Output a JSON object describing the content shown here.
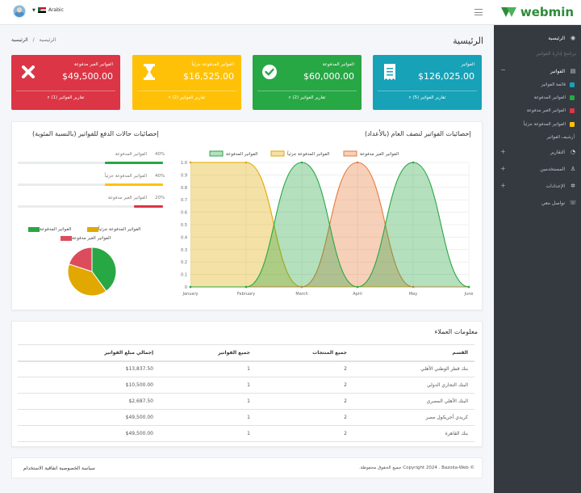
{
  "topbar": {
    "language": "Arabic"
  },
  "brand": {
    "name": "webmin"
  },
  "sidebar": {
    "home": "الرئيسية",
    "program": "برنامج إدارة الفواتير",
    "invoices": "الفواتير",
    "sub": [
      {
        "label": "قائمة الفواتير",
        "color": "#17a2b8"
      },
      {
        "label": "الفواتير المدفوعة",
        "color": "#28a745"
      },
      {
        "label": "الفواتير الغير مدفوعة",
        "color": "#dc3545"
      },
      {
        "label": "الفواتير المدفوعة جزئياً",
        "color": "#ffc107"
      },
      {
        "label": "أرشيف الفواتير",
        "color": ""
      }
    ],
    "reports": "التقارير",
    "users": "المستخدمين",
    "settings": "الإعدادات",
    "contact": "تواصل معي"
  },
  "header": {
    "breadcrumb_home": "الرئيسية",
    "breadcrumb_sep": "/",
    "breadcrumb_current": "الرئيسية",
    "title": "الرئيسية"
  },
  "cards": {
    "red": {
      "label": "الفواتير الغير مدفوعة",
      "amount": "$49,500.00",
      "link": "تقارير الفواتير (1)"
    },
    "yellow": {
      "label": "الفواتير المدفوعة جزئياً",
      "amount": "$16,525.00",
      "link": "تقارير الفواتير (2)"
    },
    "green": {
      "label": "الفواتير المدفوعة",
      "amount": "$60,000.00",
      "link": "تقارير الفواتير (2)"
    },
    "teal": {
      "label": "الفواتير",
      "amount": "$126,025.00",
      "link": "تقارير الفواتير (5)"
    }
  },
  "payments_panel": {
    "title": "إحصائيات حالات الدفع للفواتير (بالنسبة المئوية)",
    "bars": [
      {
        "label": "الفواتير المدفوعة",
        "pct": "40%",
        "value": 40,
        "color": "#28a745"
      },
      {
        "label": "الفواتير المدفوعة جزئياً",
        "pct": "40%",
        "value": 40,
        "color": "#ffc107"
      },
      {
        "label": "الفواتير الغير مدفوعة",
        "pct": "20%",
        "value": 20,
        "color": "#dc3545"
      }
    ],
    "pie_legend": [
      "الفواتير المدفوعة",
      "الفواتير المدفوعة جزئياً",
      "الفواتير الغير مدفوعة"
    ]
  },
  "chart_panel": {
    "title": "إحصائيات الفواتير لنصف العام (بالأعداد)"
  },
  "chart_data": [
    {
      "type": "area",
      "categories": [
        "January",
        "February",
        "March",
        "April",
        "May",
        "June"
      ],
      "ylim": [
        0,
        1
      ],
      "yticks": [
        "0",
        "0.1",
        "0.2",
        "0.3",
        "0.4",
        "0.5",
        "0.6",
        "0.7",
        "0.8",
        "0.9",
        "1.0"
      ],
      "series": [
        {
          "name": "الفواتير المدفوعة",
          "values": [
            0,
            0,
            1,
            0,
            1,
            0
          ],
          "color": "#28a745"
        },
        {
          "name": "الفواتير المدفوعة جزئياً",
          "values": [
            1,
            1,
            0,
            0,
            0,
            0
          ],
          "color": "#e0a800"
        },
        {
          "name": "الفواتير الغير مدفوعة",
          "values": [
            0,
            0,
            0,
            1,
            0,
            0
          ],
          "color": "#e8793a"
        }
      ],
      "legend": "top"
    },
    {
      "type": "pie",
      "categories": [
        "الفواتير المدفوعة",
        "الفواتير المدفوعة جزئياً",
        "الفواتير الغير مدفوعة"
      ],
      "values": [
        40,
        40,
        20
      ],
      "colors": [
        "#28a745",
        "#e0a800",
        "#dc4c5c"
      ]
    }
  ],
  "customers": {
    "title": "معلومات العملاء",
    "headers": [
      "القسم",
      "جميع المنتجات",
      "جميع الفواتير",
      "إجمالي مبلغ الفواتير"
    ],
    "rows": [
      [
        "بنك قطر الوطني الأهلي",
        "2",
        "1",
        "$13,837.50"
      ],
      [
        "البنك التجاري الدولي",
        "2",
        "1",
        "$10,500.00"
      ],
      [
        "البنك الأهلي المصري",
        "2",
        "1",
        "$2,687.50"
      ],
      [
        "كريدي أجريكول مصر",
        "2",
        "1",
        "$49,500.00"
      ],
      [
        "بنك القاهرة",
        "2",
        "1",
        "$49,500.00"
      ]
    ]
  },
  "footer": {
    "copyright": "© Copyright 2024 . Bazoka-Web جميع الحقوق محفوظة.",
    "terms": "اتفاقية الاستخدام",
    "privacy": "سياسة الخصوصية"
  }
}
